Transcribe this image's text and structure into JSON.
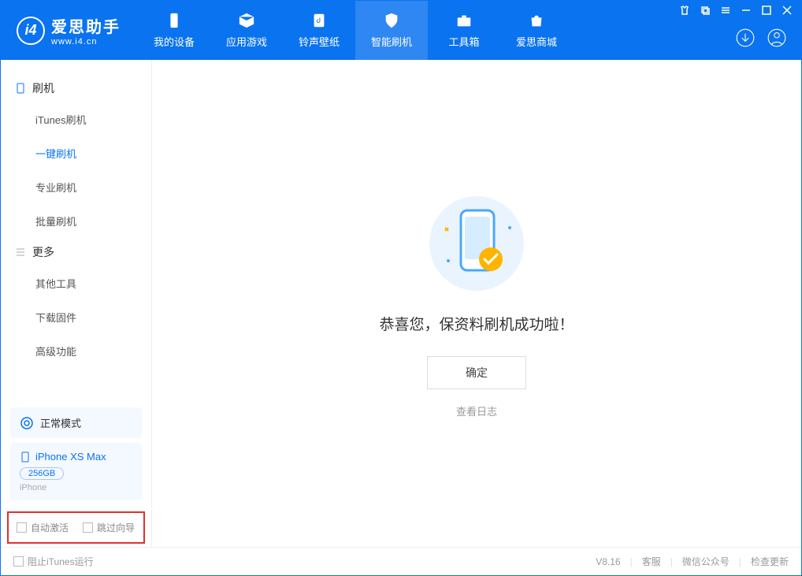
{
  "app": {
    "name": "爱思助手",
    "website": "www.i4.cn"
  },
  "nav": {
    "tabs": [
      {
        "label": "我的设备"
      },
      {
        "label": "应用游戏"
      },
      {
        "label": "铃声壁纸"
      },
      {
        "label": "智能刷机"
      },
      {
        "label": "工具箱"
      },
      {
        "label": "爱思商城"
      }
    ]
  },
  "sidebar": {
    "group1_title": "刷机",
    "group1_items": [
      "iTunes刷机",
      "一键刷机",
      "专业刷机",
      "批量刷机"
    ],
    "group2_title": "更多",
    "group2_items": [
      "其他工具",
      "下载固件",
      "高级功能"
    ]
  },
  "mode": {
    "label": "正常模式"
  },
  "device": {
    "name": "iPhone XS Max",
    "capacity": "256GB",
    "type": "iPhone"
  },
  "options": {
    "auto_activate": "自动激活",
    "skip_guide": "跳过向导"
  },
  "main": {
    "success_message": "恭喜您，保资料刷机成功啦！",
    "ok_button": "确定",
    "view_log": "查看日志"
  },
  "footer": {
    "block_itunes": "阻止iTunes运行",
    "version": "V8.16",
    "links": [
      "客服",
      "微信公众号",
      "检查更新"
    ]
  }
}
